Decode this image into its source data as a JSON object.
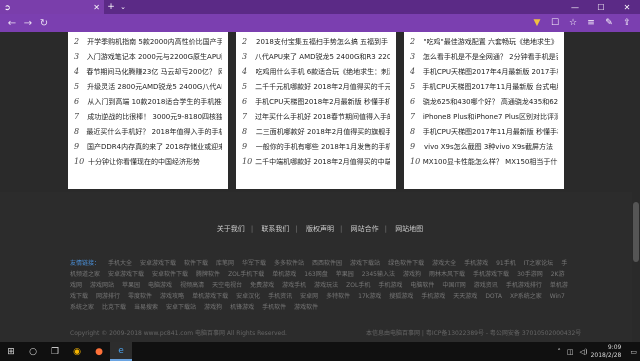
{
  "browser": {
    "tab_title": "",
    "nav_icons": [
      "back-icon",
      "refresh-icon",
      "home-icon"
    ],
    "toolbar_icons": [
      "reading-view-icon",
      "favorite-icon",
      "hub-icon",
      "notes-icon",
      "share-icon"
    ]
  },
  "columns": [
    {
      "items": [
        {
          "n": "2",
          "text": "开学季购机指南 5款2000内高性价比国产手机"
        },
        {
          "n": "3",
          "text": "入门游戏笔记本 2000元与2200G原生APU配置"
        },
        {
          "n": "4",
          "text": "春节期间马化腾赚23亿 马云却亏200亿？ 网友评"
        },
        {
          "n": "5",
          "text": "升级灵活 2800元AMD锐龙5 2400G八代APU"
        },
        {
          "n": "6",
          "text": "从入门到高端 10款2018适合学生的手机推荐"
        },
        {
          "n": "7",
          "text": "成功逆战的比很棒！ 3000元9-8180四核独显"
        },
        {
          "n": "8",
          "text": "最近买什么手机好？ 2018年值得入手的手机推荐"
        },
        {
          "n": "9",
          "text": "国产DDR4内存真的来了 2018存储业或迎来大"
        },
        {
          "n": "10",
          "text": "十分钟让你看懂现在的中国经济形势"
        }
      ]
    },
    {
      "items": [
        {
          "n": "2",
          "text": "2018支付宝集五福扫手势怎么搞 五福到手"
        },
        {
          "n": "3",
          "text": "八代APU来了 AMD锐龙5 2400G和R3 2200G"
        },
        {
          "n": "4",
          "text": "吃鸡用什么手机 6款适合玩《绝地求生：刺激"
        },
        {
          "n": "5",
          "text": "二千千元机哪款好 2018年2月值得买的千元手"
        },
        {
          "n": "6",
          "text": "手机CPU天梯图2018年2月最新版 秒懂手机处"
        },
        {
          "n": "7",
          "text": "过年买什么手机好 2018春节期间值得入手的手"
        },
        {
          "n": "8",
          "text": "二三面机哪款好 2018年2月值得买的旗舰手"
        },
        {
          "n": "9",
          "text": "一般你的手机有哪些 2018年1月发售的手机"
        },
        {
          "n": "10",
          "text": "二千中端机哪款好 2018年2月值得买的中端手"
        }
      ]
    },
    {
      "items": [
        {
          "n": "2",
          "text": "\"吃鸡\"最佳游戏配置 六套畅玩《绝地求生》电"
        },
        {
          "n": "3",
          "text": "怎么看手机是不是全网通？ 2分钟看手机是否全"
        },
        {
          "n": "4",
          "text": "手机CPU天梯图2017年4月最新版 2017手机处"
        },
        {
          "n": "5",
          "text": "手机CPU天梯图2017年11月最新版 台式电脑处理"
        },
        {
          "n": "6",
          "text": "骁龙625和430哪个好？ 高通骁龙435和625区"
        },
        {
          "n": "7",
          "text": "iPhone8 Plus和iPhone7 Plus区别对比评测 最"
        },
        {
          "n": "8",
          "text": "手机CPU天梯图2017年11月最新版 秒懂手机处"
        },
        {
          "n": "9",
          "text": "vivo X9s怎么截图 3种vivo X9s截屏方法"
        },
        {
          "n": "10",
          "text": "MX100显卡性能怎么样？ MX150相当于什么显"
        }
      ]
    }
  ],
  "footer": {
    "nav": [
      "关于我们",
      "联系我们",
      "版权声明",
      "网站合作",
      "网站地图"
    ],
    "links_label": "友情链接：",
    "links": [
      "手机大全",
      "安卓游戏下载",
      "软件下载",
      "库笔网",
      "华军下载",
      "多多软件站",
      "西西软件园",
      "游戏下载站",
      "绿色软件下载",
      "游戏大全",
      "手机游戏",
      "91手机",
      "IT之家论坛",
      "手机频道之家",
      "安卓游戏下载",
      "安卓软件下载",
      "腾牌软件",
      "ZOL手机下载",
      "单机游戏",
      "163网盘",
      "苹果园",
      "2345输入法",
      "游戏狗",
      "雨林木风下载",
      "手机游戏下载",
      "30手游网",
      "2K游戏网",
      "游戏网站",
      "苹果园",
      "电脑游戏",
      "视频高清",
      "天空电视台",
      "免费游戏",
      "游戏手机",
      "游戏玩法",
      "ZOL手机",
      "手机游戏",
      "电脑软件",
      "中国IT网",
      "游戏资讯",
      "手机游戏排行",
      "单机游戏下载",
      "网游排行",
      "零度软件",
      "游戏攻略",
      "单机游戏下载",
      "安卓汉化",
      "手机资讯",
      "安卓网",
      "多特软件",
      "17k游戏",
      "搜狐游戏",
      "手机游戏",
      "天天游戏",
      "DOTA",
      "XP系统之家",
      "Win7系统之家",
      "比克下载",
      "当易搜索",
      "安卓下载站",
      "游戏狗",
      "机锋游戏",
      "手机软件",
      "游戏软件"
    ],
    "copyright": "Copyright © 2009-2018 www.pc841.com 电脑百事网 All Rights Reserved.",
    "icp": "本信息由电脑百事网 | 粤ICP备13022389号 - 粤公网安备 37010502000432号"
  },
  "taskbar": {
    "apps": [
      "windows-start-icon",
      "search-icon",
      "task-view-icon",
      "chrome-icon",
      "firefox-icon",
      "edge-icon"
    ],
    "time": "9:09",
    "date": "2018/2/28"
  }
}
